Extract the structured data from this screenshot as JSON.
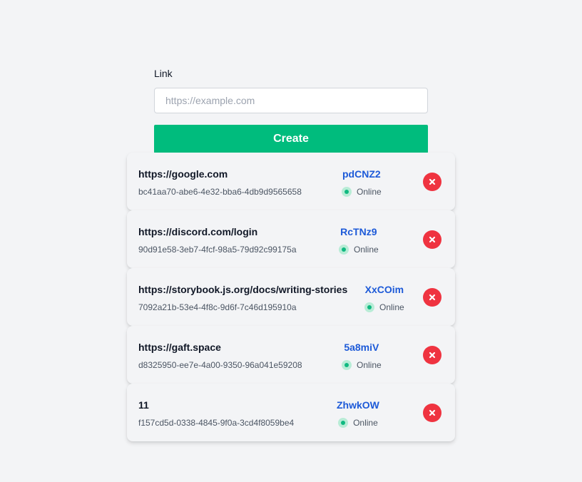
{
  "form": {
    "label": "Link",
    "input_placeholder": "https://example.com",
    "input_value": "",
    "create_label": "Create"
  },
  "links": [
    {
      "url": "https://google.com",
      "id": "bc41aa70-abe6-4e32-bba6-4db9d9565658",
      "slug": "pdCNZ2",
      "status": "Online"
    },
    {
      "url": "https://discord.com/login",
      "id": "90d91e58-3eb7-4fcf-98a5-79d92c99175a",
      "slug": "RcTNz9",
      "status": "Online"
    },
    {
      "url": "https://storybook.js.org/docs/writing-stories",
      "id": "7092a21b-53e4-4f8c-9d6f-7c46d195910a",
      "slug": "XxCOim",
      "status": "Online"
    },
    {
      "url": "https://gaft.space",
      "id": "d8325950-ee7e-4a00-9350-96a041e59208",
      "slug": "5a8miV",
      "status": "Online"
    },
    {
      "url": "11",
      "id": "f157cd5d-0338-4845-9f0a-3cd4f8059be4",
      "slug": "ZhwkOW",
      "status": "Online"
    }
  ],
  "icons": {
    "delete": "close-circle-icon",
    "status": "online-dot-icon"
  },
  "colors": {
    "accent": "#00bc7d",
    "slug": "#1d5ad8",
    "delete": "#ef3340",
    "online": "#10b981"
  }
}
